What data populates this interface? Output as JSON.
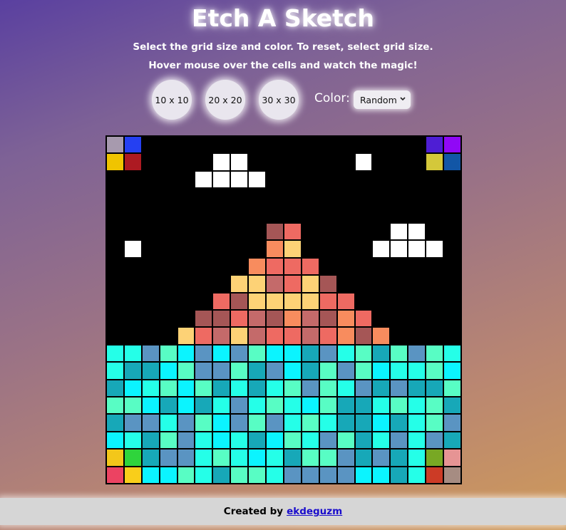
{
  "header": {
    "title": "Etch A Sketch",
    "instructions": "Select the grid size and color. To reset, select grid size.",
    "hint": "Hover mouse over the cells and watch the magic!"
  },
  "controls": {
    "size_buttons": [
      "10 x 10",
      "20 x 20",
      "30 x 30"
    ],
    "color_label": "Color:",
    "color_select_value": "Random",
    "chevron_icon": "chevron-down-icon"
  },
  "grid": {
    "rows": 20,
    "cols": 20,
    "default_color": "#000000",
    "palette": {
      "w": "#ffffff",
      "a": "#a55656",
      "b": "#ee6a62",
      "c": "#f88c5e",
      "d": "#fdd276",
      "e": "#c46a6a",
      "t1": "#25ffe8",
      "t2": "#17a8b8",
      "t3": "#0bf4ff",
      "t4": "#58fdc4",
      "t5": "#5a94c2",
      "g1": "#a79aae",
      "g2": "#2540f2",
      "g3": "#f0c400",
      "g4": "#ad1a22",
      "g5": "#4e1ed4",
      "g6": "#9008f6",
      "g7": "#d4c83a",
      "g8": "#1256a6",
      "g9": "#f3c71a",
      "g10": "#2fd43c",
      "g11": "#78a824",
      "g12": "#e69494",
      "g13": "#ec4362",
      "g14": "#f9ce1a",
      "g15": "#cc3b26",
      "g16": "#a68c82"
    },
    "rows_data": [
      "g1 g2 . . . . . . . . . . . . . . . . g5 g6",
      "g3 g4 . . . . w w . . . . . . w . . . g7 g8",
      ". . . . . w w w w . . . . . . . . . . .",
      ". . . . . . . . . . . . . . . . . . . .",
      ". . . . . . . . . . . . . . . . . . . .",
      ". . . . . . . . . a b . . . . . w w . .",
      ". w . . . . . . . c d . . . . w w w w .",
      ". . . . . . . . c b b b . . . . . . . .",
      ". . . . . . . d d e b d a . . . . . . .",
      ". . . . . . b a d d d d b b . . . . . .",
      ". . . . . a a b e a c e a c b . . . . .",
      ". . . . d b e d e b b e b c a c . . . .",
      "t1 t1 t5 t4 t3 t5 t3 t5 t4 t3 t3 t2 t5 t1 t4 t2 t4 t5 t4 t1",
      "t1 t2 t2 t3 t4 t5 t5 t4 t2 t5 t3 t2 t4 t5 t4 t3 t1 t1 t4 t3",
      "t2 t3 t1 t4 t3 t4 t2 t1 t2 t1 t4 t5 t4 t1 t5 t2 t5 t2 t2 t4",
      "t4 t4 t3 t2 t3 t2 t1 t5 t1 t4 t1 t3 t4 t2 t2 t1 t4 t1 t4 t2",
      "t2 t5 t5 t1 t5 t4 t3 t5 t4 t5 t1 t4 t1 t2 t2 t3 t2 t1 t4 t5",
      "t3 t1 t2 t4 t5 t1 t3 t1 t2 t3 t4 t1 t5 t4 t2 t1 t5 t1 t5 t2",
      "g9 g10 t2 t5 t5 t1 t4 t1 t3 t1 t2 t4 t4 t5 t2 t5 t2 t1 g11 g12",
      "g13 g14 t3 t3 t4 t1 t2 t4 t4 t1 t5 t5 t5 t5 t3 t3 t2 t1 g15 g16"
    ]
  },
  "footer": {
    "created_by": "Created by",
    "author_link": "ekdeguzm"
  }
}
